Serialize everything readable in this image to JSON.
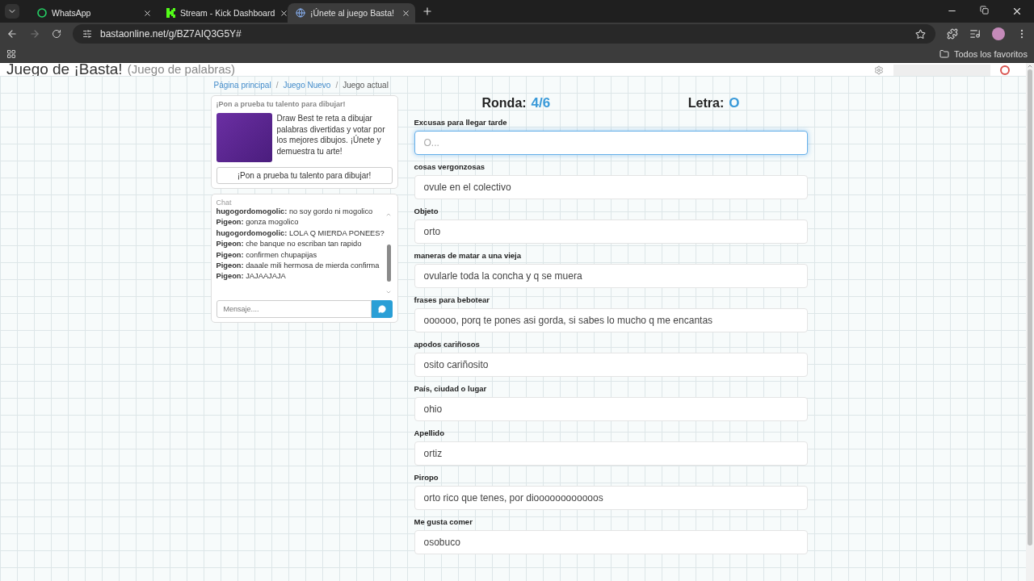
{
  "browser": {
    "tabs": [
      {
        "title": "WhatsApp",
        "selected": false
      },
      {
        "title": "Stream - Kick Dashboard",
        "selected": false
      },
      {
        "title": "¡Únete al juego Basta!",
        "selected": true
      }
    ],
    "url": "bastaonline.net/g/BZ7AIQ3G5Y#",
    "bookmarks_folder": "Todos los favoritos"
  },
  "page": {
    "title": "Juego de ¡Basta!",
    "subtitle": "(Juego de palabras)",
    "breadcrumb_separator": "/",
    "breadcrumbs": [
      {
        "label": "Página principal",
        "link": true
      },
      {
        "label": "Juego Nuevo",
        "link": true
      },
      {
        "label": "Juego actual",
        "link": false
      }
    ],
    "promo": {
      "heading": "¡Pon a prueba tu talento para dibujar!",
      "text": "Draw Best te reta a dibujar palabras divertidas y votar por los mejores dibujos. ¡Únete y demuestra tu arte!",
      "button": "¡Pon a prueba tu talento para dibujar!"
    },
    "chat": {
      "title": "Chat",
      "messages": [
        {
          "user": "hugogordomogolic:",
          "text": "no soy gordo ni mogolico"
        },
        {
          "user": "Pigeon:",
          "text": "gonza mogolico"
        },
        {
          "user": "hugogordomogolic:",
          "text": "LOLA Q MIERDA PONEES?"
        },
        {
          "user": "Pigeon:",
          "text": "che banque no escriban tan rapido"
        },
        {
          "user": "Pigeon:",
          "text": "confirmen chupapijas"
        },
        {
          "user": "Pigeon:",
          "text": "daaale mili hermosa de mierda confirma"
        },
        {
          "user": "Pigeon:",
          "text": "JAJAAJAJA"
        }
      ],
      "placeholder": "Mensaje...."
    },
    "round_label": "Ronda:",
    "round": "4/6",
    "letter_label": "Letra:",
    "letter": "O",
    "fields": [
      {
        "label": "Excusas para llegar tarde",
        "placeholder": "O...",
        "focused": true
      },
      {
        "label": "cosas vergonzosas",
        "value": "ovule en el colectivo",
        "focused": false
      },
      {
        "label": "Objeto",
        "value": "orto",
        "focused": false
      },
      {
        "label": "maneras de matar a una vieja",
        "value": "ovularle toda la concha y q se muera",
        "focused": false
      },
      {
        "label": "frases para bebotear",
        "value": "oooooo, porq te pones asi gorda, si sabes lo mucho q me encantas",
        "focused": false
      },
      {
        "label": "apodos cariñosos",
        "value": "osito cariñosito",
        "focused": false
      },
      {
        "label": "País, ciudad o lugar",
        "value": "ohio",
        "focused": false
      },
      {
        "label": "Apellido",
        "value": "ortiz",
        "focused": false
      },
      {
        "label": "Piropo",
        "value": "orto rico que tenes, por dioooooooooooos",
        "focused": false
      },
      {
        "label": "Me gusta comer",
        "value": "osobuco",
        "focused": false
      }
    ]
  }
}
